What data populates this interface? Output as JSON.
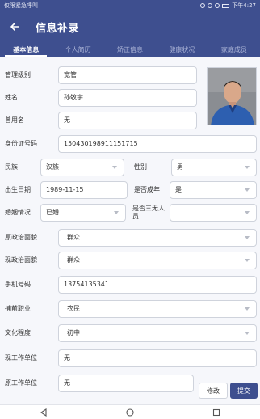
{
  "status_bar": {
    "left_text": "仅限紧急呼叫",
    "time": "下午4:27"
  },
  "app_bar": {
    "title": "信息补录"
  },
  "tabs": [
    {
      "label": "基本信息",
      "active": true
    },
    {
      "label": "个人简历",
      "active": false
    },
    {
      "label": "矫正信息",
      "active": false
    },
    {
      "label": "健康状况",
      "active": false
    },
    {
      "label": "家庭成员",
      "active": false
    }
  ],
  "form": {
    "management_level": {
      "label": "管理级别",
      "value": "宽管"
    },
    "name": {
      "label": "姓名",
      "value": "孙敬宇"
    },
    "former_name": {
      "label": "曾用名",
      "value": "无"
    },
    "id_number": {
      "label": "身份证号码",
      "value": "150430198911151715"
    },
    "ethnicity": {
      "label": "民族",
      "value": "汉族"
    },
    "gender": {
      "label": "性别",
      "value": "男"
    },
    "birth_date": {
      "label": "出生日期",
      "value": "1989-11-15"
    },
    "is_adult": {
      "label": "是否成年",
      "value": "是"
    },
    "marital_status": {
      "label": "婚姻情况",
      "value": "已婚"
    },
    "is_three_none": {
      "label_line1": "是否三无人",
      "label_line2": "员",
      "value": ""
    },
    "former_political": {
      "label": "原政治面貌",
      "value": "群众"
    },
    "current_political": {
      "label": "现政治面貌",
      "value": "群众"
    },
    "phone": {
      "label": "手机号码",
      "value": "13754135341"
    },
    "pre_arrest_job": {
      "label": "捕前职业",
      "value": "农民"
    },
    "education": {
      "label": "文化程度",
      "value": "初中"
    },
    "current_employer": {
      "label": "现工作单位",
      "value": "无"
    },
    "former_employer": {
      "label": "原工作单位",
      "value": "无"
    }
  },
  "buttons": {
    "modify": "修改",
    "submit": "提交"
  },
  "colors": {
    "primary": "#3e4f8f",
    "border": "#cfd3dc"
  }
}
